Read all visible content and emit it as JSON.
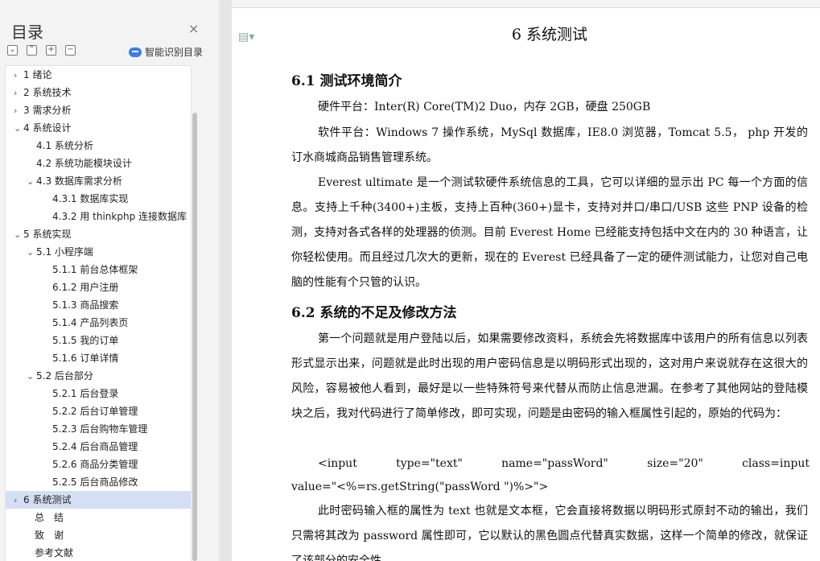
{
  "toc": {
    "title": "目录",
    "close_icon": "×",
    "smart_label": "智能识别目录",
    "items": [
      {
        "label": "1 绪论",
        "level": 1,
        "arrow": "right"
      },
      {
        "label": "2 系统技术",
        "level": 1,
        "arrow": "right"
      },
      {
        "label": "3 需求分析",
        "level": 1,
        "arrow": "right"
      },
      {
        "label": "4 系统设计",
        "level": 1,
        "arrow": "down"
      },
      {
        "label": "4.1 系统分析",
        "level": 2,
        "arrow": ""
      },
      {
        "label": "4.2 系统功能模块设计",
        "level": 2,
        "arrow": ""
      },
      {
        "label": "4.3 数据库需求分析",
        "level": 2,
        "arrow": "down"
      },
      {
        "label": "4.3.1 数据库实现",
        "level": 3,
        "arrow": ""
      },
      {
        "label": "4.3.2 用 thinkphp 连接数据库",
        "level": 3,
        "arrow": ""
      },
      {
        "label": "5 系统实现",
        "level": 1,
        "arrow": "down"
      },
      {
        "label": "5.1 小程序端",
        "level": 2,
        "arrow": "down"
      },
      {
        "label": "5.1.1 前台总体框架",
        "level": 3,
        "arrow": ""
      },
      {
        "label": "6.1.2 用户注册",
        "level": 3,
        "arrow": ""
      },
      {
        "label": "5.1.3 商品搜索",
        "level": 3,
        "arrow": ""
      },
      {
        "label": "5.1.4 产品列表页",
        "level": 3,
        "arrow": ""
      },
      {
        "label": "5.1.5 我的订单",
        "level": 3,
        "arrow": ""
      },
      {
        "label": "5.1.6 订单详情",
        "level": 3,
        "arrow": ""
      },
      {
        "label": "5.2 后台部分",
        "level": 2,
        "arrow": "down"
      },
      {
        "label": "5.2.1 后台登录",
        "level": 3,
        "arrow": ""
      },
      {
        "label": "5.2.2 后台订单管理",
        "level": 3,
        "arrow": ""
      },
      {
        "label": "5.2.3 后台购物车管理",
        "level": 3,
        "arrow": ""
      },
      {
        "label": "5.2.4 后台商品管理",
        "level": 3,
        "arrow": ""
      },
      {
        "label": "5.2.6 商品分类管理",
        "level": 3,
        "arrow": ""
      },
      {
        "label": "5.2.5 后台商品修改",
        "level": 3,
        "arrow": ""
      },
      {
        "label": "6 系统测试",
        "level": 1,
        "arrow": "right",
        "selected": true
      },
      {
        "label": "总　结",
        "level": 0,
        "arrow": ""
      },
      {
        "label": "致　谢",
        "level": 0,
        "arrow": ""
      },
      {
        "label": "参考文献",
        "level": 0,
        "arrow": ""
      }
    ]
  },
  "doc": {
    "chapter_title": "6 系统测试",
    "h_61": "6.1  测试环境简介",
    "p_hw": "硬件平台：Inter(R) Core(TM)2 Duo，内存 2GB，硬盘 250GB",
    "p_sw": "软件平台：Windows 7 操作系统，MySql 数据库，IE8.0 浏览器，Tomcat 5.5， php 开发的订水商城商品销售管理系统。",
    "p_everest": "Everest ultimate 是一个测试软硬件系统信息的工具，它可以详细的显示出 PC 每一个方面的信息。支持上千种(3400+)主板，支持上百种(360+)显卡，支持对并口/串口/USB 这些 PNP 设备的检测，支持对各式各样的处理器的侦测。目前 Everest Home 已经能支持包括中文在内的 30 种语言，让你轻松使用。而且经过几次大的更新，现在的 Everest 已经具备了一定的硬件测试能力，让您对自己电脑的性能有个只管的认识。",
    "h_62": "6.2  系统的不足及修改方法",
    "p_issue": "第一个问题就是用户登陆以后，如果需要修改资料，系统会先将数据库中该用户的所有信息以列表形式显示出来，问题就是此时出现的用户密码信息是以明码形式出现的，这对用户来说就存在这很大的风险，容易被他人看到，最好是以一些特殊符号来代替从而防止信息泄漏。在参考了其他网站的登陆模块之后，我对代码进行了简单修改，即可实现，问题是由密码的输入框属性引起的，原始的代码为：",
    "code_parts": [
      "<input",
      "type=\"text\"",
      "name=\"passWord\"",
      "size=\"20\"",
      "class=input"
    ],
    "code_line2": "value=\"<%=rs.getString(\"passWord \")%>\">",
    "p_fix": "此时密码输入框的属性为 text 也就是文本框，它会直接将数据以明码形式原封不动的输出，我们只需将其改为 password 属性即可，它以默认的黑色圆点代替真实数据，这样一个简单的修改，就保证了该部分的安全性。"
  }
}
